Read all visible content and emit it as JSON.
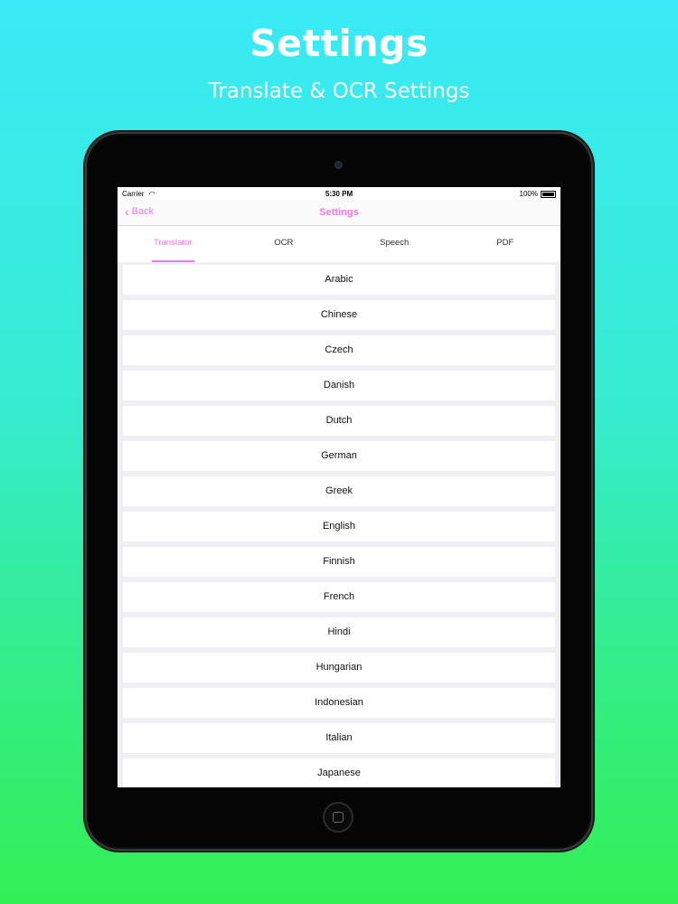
{
  "promo": {
    "title": "Settings",
    "subtitle": "Translate & OCR Settings"
  },
  "status_bar": {
    "carrier": "Carrier",
    "time": "5:30 PM",
    "battery": "100%"
  },
  "nav": {
    "back_label": "Back",
    "title": "Settings"
  },
  "tabs": [
    {
      "label": "Translator",
      "active": true
    },
    {
      "label": "OCR",
      "active": false
    },
    {
      "label": "Speech",
      "active": false
    },
    {
      "label": "PDF",
      "active": false
    }
  ],
  "languages": [
    "Arabic",
    "Chinese",
    "Czech",
    "Danish",
    "Dutch",
    "German",
    "Greek",
    "English",
    "Finnish",
    "French",
    "Hindi",
    "Hungarian",
    "Indonesian",
    "Italian",
    "Japanese"
  ],
  "colors": {
    "accent": "#f078e8",
    "background_top": "#3aeaf6",
    "background_bottom": "#33ef55"
  }
}
